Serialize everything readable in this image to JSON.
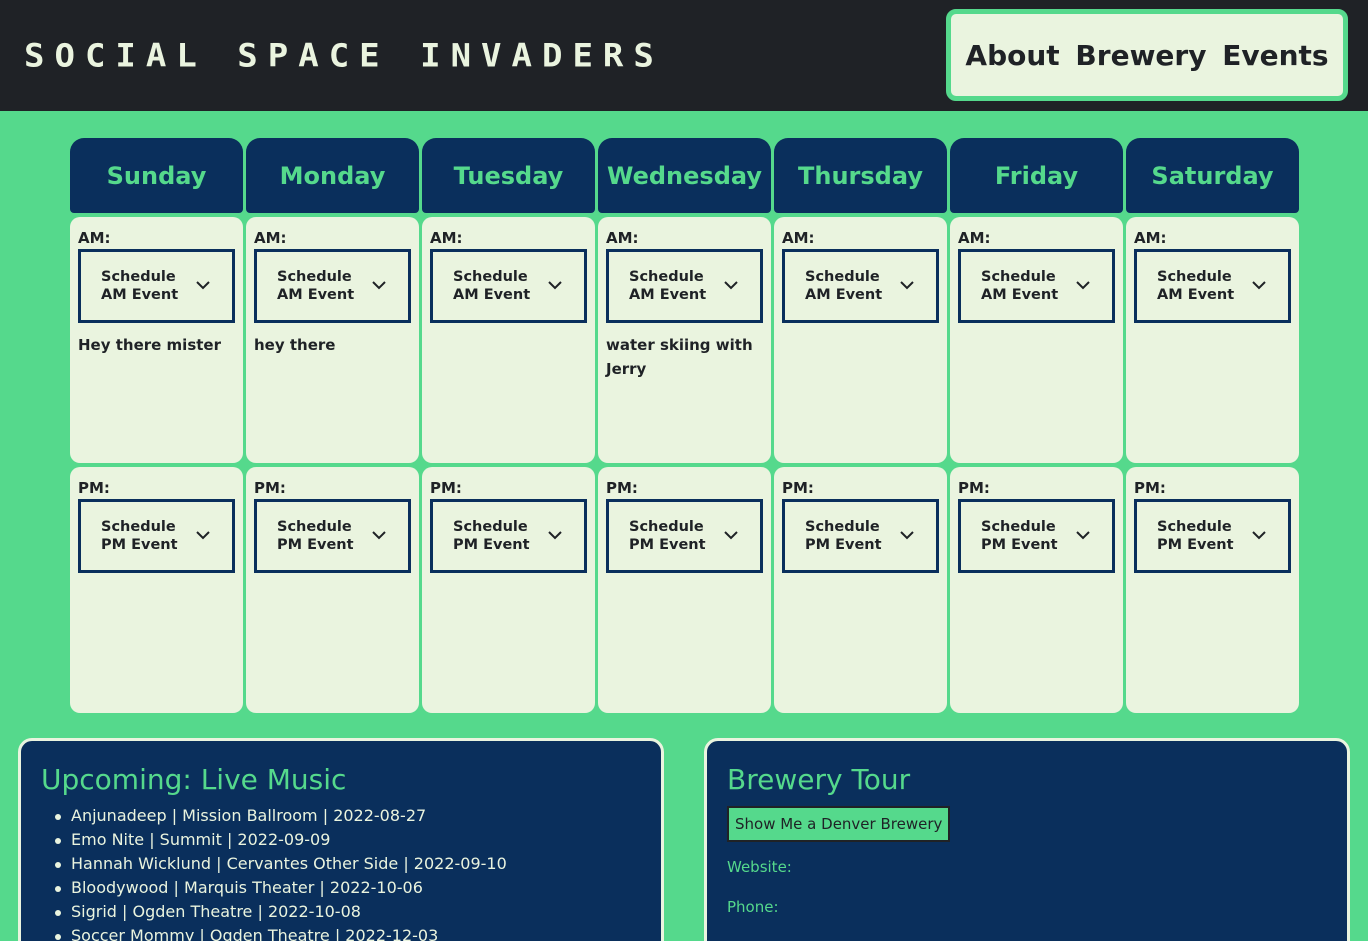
{
  "header": {
    "brand": "Social Space Invaders",
    "about_button": "About Brewery Events"
  },
  "calendar": {
    "am_label": "AM:",
    "pm_label": "PM:",
    "am_select_placeholder": "Schedule AM Event",
    "pm_select_placeholder": "Schedule PM Event",
    "days": [
      {
        "name": "Sunday",
        "am_note": "Hey there mister",
        "pm_note": ""
      },
      {
        "name": "Monday",
        "am_note": "hey there",
        "pm_note": ""
      },
      {
        "name": "Tuesday",
        "am_note": "",
        "pm_note": ""
      },
      {
        "name": "Wednesday",
        "am_note": "water skiing with Jerry",
        "pm_note": ""
      },
      {
        "name": "Thursday",
        "am_note": "",
        "pm_note": ""
      },
      {
        "name": "Friday",
        "am_note": "",
        "pm_note": ""
      },
      {
        "name": "Saturday",
        "am_note": "",
        "pm_note": ""
      }
    ]
  },
  "live_music": {
    "title": "Upcoming: Live Music",
    "events": [
      "Anjunadeep | Mission Ballroom | 2022-08-27",
      "Emo Nite | Summit | 2022-09-09",
      "Hannah Wicklund | Cervantes Other Side | 2022-09-10",
      "Bloodywood | Marquis Theater | 2022-10-06",
      "Sigrid | Ogden Theatre | 2022-10-08",
      "Soccer Mommy | Ogden Theatre | 2022-12-03"
    ]
  },
  "brewery_tour": {
    "title": "Brewery Tour",
    "button": "Show Me a Denver Brewery",
    "website_label": "Website:",
    "phone_label": "Phone:"
  },
  "colors": {
    "background": "#55d98c",
    "header_bg": "#1f2226",
    "navy": "#0a2f5c",
    "cream": "#eaf4df"
  },
  "icons": {
    "select_arrow": "chevron-down-icon"
  }
}
